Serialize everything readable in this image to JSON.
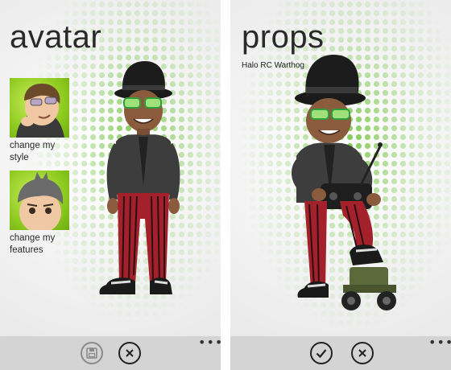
{
  "left_screen": {
    "title": "avatar",
    "tiles": [
      {
        "label_line1": "change my",
        "label_line2": "style"
      },
      {
        "label_line1": "change my",
        "label_line2": "features"
      }
    ],
    "appbar": {
      "more": "•••"
    }
  },
  "right_screen": {
    "title": "props",
    "subtitle": "Halo RC Warthog",
    "appbar": {
      "more": "•••"
    }
  },
  "icons": {
    "save": "save-icon",
    "cancel": "close-icon",
    "confirm": "checkmark-icon"
  },
  "colors": {
    "tile_green": "#8fcb20",
    "dots_green": "#6cc23a",
    "appbar": "#d4d4d4"
  }
}
